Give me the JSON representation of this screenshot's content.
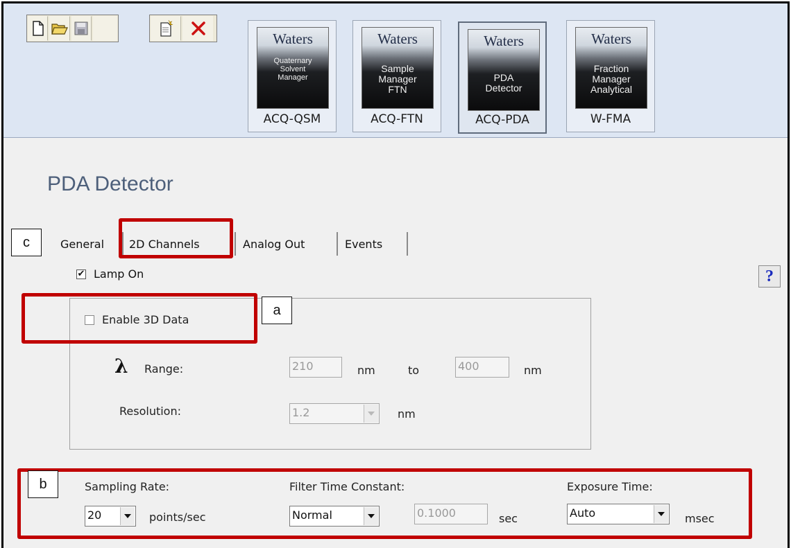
{
  "toolbar": {
    "buttons": [
      "new-icon",
      "open-folder-icon",
      "save-icon",
      "new-document-icon",
      "delete-icon"
    ]
  },
  "instruments": [
    {
      "brand": "Waters",
      "description": "Quaternary\nSolvent\nManager",
      "label": "ACQ-QSM",
      "selected": false
    },
    {
      "brand": "Waters",
      "description": "Sample\nManager\nFTN",
      "label": "ACQ-FTN",
      "selected": false
    },
    {
      "brand": "Waters",
      "description": "PDA\nDetector",
      "label": "ACQ-PDA",
      "selected": true
    },
    {
      "brand": "Waters",
      "description": "Fraction\nManager\nAnalytical",
      "label": "W-FMA",
      "selected": false
    }
  ],
  "page_title": "PDA Detector",
  "tabs": [
    {
      "label": "General",
      "active": true
    },
    {
      "label": "2D Channels",
      "active": false
    },
    {
      "label": "Analog Out",
      "active": false
    },
    {
      "label": "Events",
      "active": false
    }
  ],
  "help_label": "?",
  "lamp": {
    "label": "Lamp On",
    "checked": true,
    "mark": "✔"
  },
  "data3d": {
    "enable_label": "Enable 3D Data",
    "enabled": false,
    "lambda_symbol": "λ",
    "range_label": "Range:",
    "range_from": "210",
    "range_to": "400",
    "unit_nm": "nm",
    "to_label": "to",
    "resolution_label": "Resolution:",
    "resolution_value": "1.2"
  },
  "sampling": {
    "sampling_rate_label": "Sampling Rate:",
    "sampling_rate_value": "20",
    "sampling_rate_unit": "points/sec",
    "filter_label": "Filter Time Constant:",
    "filter_value": "Normal",
    "filter_time_value": "0.1000",
    "filter_unit": "sec",
    "exposure_label": "Exposure Time:",
    "exposure_value": "Auto",
    "exposure_unit": "msec"
  },
  "callouts": {
    "a": "a",
    "b": "b",
    "c": "c"
  },
  "colors": {
    "highlight": "#c00000",
    "title": "#4d5f7a",
    "help": "#1a2bbd"
  }
}
